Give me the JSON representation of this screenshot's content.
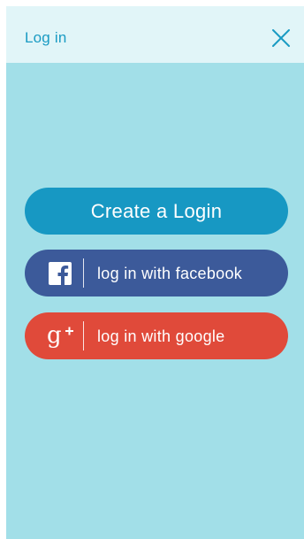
{
  "header": {
    "title": "Log in",
    "close_icon": "close-icon"
  },
  "buttons": {
    "create_login": "Create a Login",
    "facebook": "log in with facebook",
    "google": "log in with google"
  },
  "icons": {
    "facebook": "facebook-icon",
    "google": "google-plus-icon"
  },
  "colors": {
    "background": "#a2dfe8",
    "header_bg": "#e1f5f8",
    "accent": "#1a9bc3",
    "create_button": "#1798c3",
    "facebook_button": "#3c5a9a",
    "google_button": "#e04a3a"
  }
}
